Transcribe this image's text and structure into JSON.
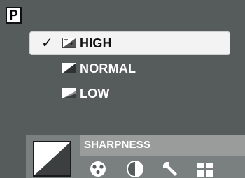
{
  "mode": {
    "label": "P"
  },
  "menu": {
    "items": [
      {
        "label": "HIGH",
        "checked": true,
        "check_glyph": "✓",
        "icon": "sharpness-high-icon"
      },
      {
        "label": "NORMAL",
        "checked": false,
        "icon": "sharpness-normal-icon"
      },
      {
        "label": "LOW",
        "checked": false,
        "icon": "sharpness-low-icon"
      }
    ]
  },
  "status": {
    "title": "SHARPNESS",
    "preview_icon": "sharpness-preview-icon",
    "tabs": [
      {
        "icon": "color-palette-icon"
      },
      {
        "icon": "contrast-icon"
      },
      {
        "icon": "wrench-icon"
      },
      {
        "icon": "grid-icon"
      }
    ]
  },
  "colors": {
    "background": "#565b5b",
    "highlight": "#f3f3f3",
    "status_bar": "#7a7f80",
    "status_title": "#9a9c9c"
  }
}
